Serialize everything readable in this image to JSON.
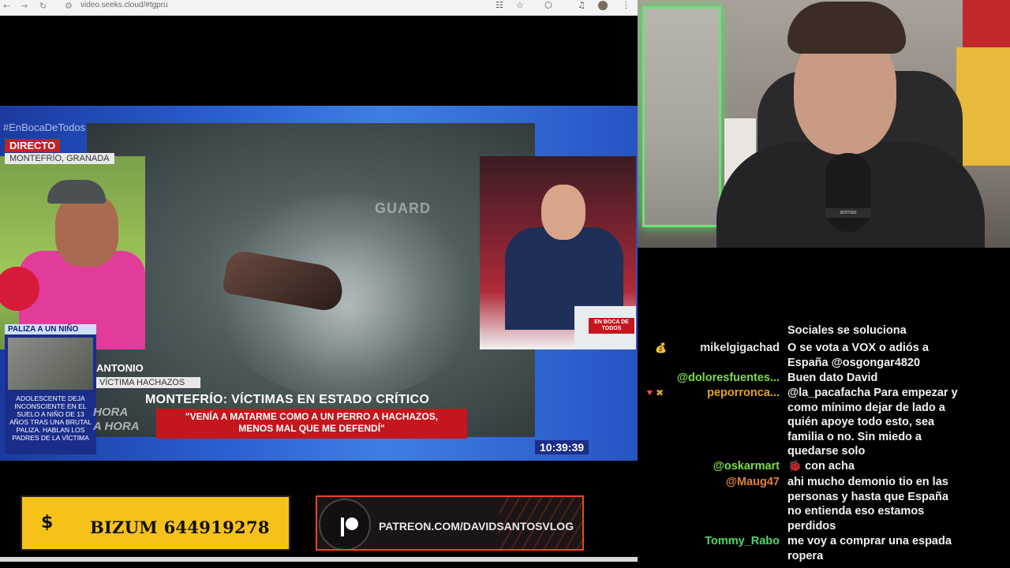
{
  "browser": {
    "url": "video.seeks.cloud/#tgpru",
    "back_icon": "←",
    "forward_icon": "→",
    "reload_icon": "↻",
    "translate_icon": "☷",
    "star_icon": "☆",
    "extensions_icon": "⬡",
    "menu_icon": "⋮"
  },
  "tv": {
    "hashtag": "#EnBocaDeTodos",
    "live_label": "DIRECTO",
    "location": "MONTEFRÍO, GRANADA",
    "side_news_header": "PALIZA A UN NIÑO",
    "side_news_text": "ADOLESCENTE DEJA INCONSCIENTE EN EL SUELO A NIÑO DE 13 AÑOS TRAS UNA BRUTAL PALIZA. HABLAN LOS PADRES DE LA VÍCTIMA",
    "interviewee_name": "ANTONIO",
    "interviewee_role": "VÍCTIMA HACHAZOS",
    "headline": "MONTEFRÍO: VÍCTIMAS EN ESTADO CRÍTICO",
    "quote_line1": "\"VENÍA A MATARME COMO A UN PERRO A HACHAZOS,",
    "quote_line2": "MENOS MAL QUE ME DEFENDÍ\"",
    "hora_line1": "HORA",
    "hora_line2": "A HORA",
    "clock": "10:39:39",
    "background_text": "GUARD",
    "studio_logo": "EN BOCA DE TODOS"
  },
  "banners": {
    "bizum_label": "BIZUM 644919278",
    "bizum_icon": "$",
    "patreon_label": "PATREON.COM/DAVIDSANTOSVLOG"
  },
  "webcam": {
    "mic_brand": "anmas"
  },
  "chat": {
    "clipped_text": "Sociales se soluciona",
    "messages": [
      {
        "user": "mikelgigachad",
        "user_color": "#e7e7e7",
        "badge": "💰",
        "lines": [
          "O se vota a VOX o adiós a",
          "España @osgongar4820"
        ]
      },
      {
        "user": "@doloresfuentes...",
        "user_color": "#7ddc4a",
        "badge": "",
        "lines": [
          "Buen dato David"
        ]
      },
      {
        "user": "peporronca...",
        "user_color": "#e6a423",
        "badge": "🔻✖",
        "lines": [
          "@la_pacafacha Para empezar y",
          "como mínimo dejar de lado a",
          "quién apoye todo esto, sea",
          "familia o no. Sin miedo a",
          "quedarse solo"
        ]
      },
      {
        "user": "@oskarmart",
        "user_color": "#7ddc4a",
        "badge": "",
        "lines": [
          "🐞 con acha"
        ]
      },
      {
        "user": "@Maug47",
        "user_color": "#e0823a",
        "badge": "",
        "lines": [
          "ahi mucho demonio tio en las",
          "personas y hasta que España",
          "no entienda eso estamos",
          "perdidos"
        ]
      },
      {
        "user": "Tommy_Rabo",
        "user_color": "#4cd66a",
        "badge": "",
        "lines": [
          "me voy a comprar una espada",
          "ropera"
        ]
      }
    ]
  }
}
